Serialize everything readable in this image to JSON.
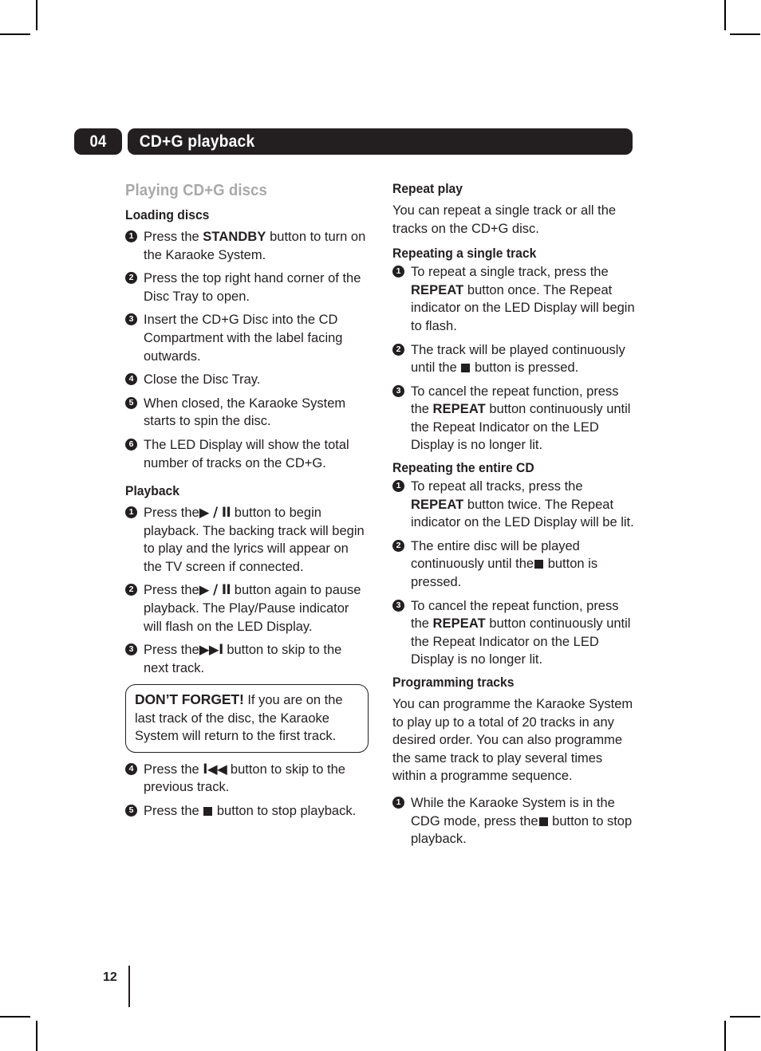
{
  "header": {
    "chapter_number": "04",
    "title": "CD+G playback"
  },
  "left_column": {
    "section_title": "Playing CD+G discs",
    "loading": {
      "heading": "Loading discs",
      "steps": [
        {
          "n": "1",
          "parts": [
            {
              "t": "text",
              "v": "Press the "
            },
            {
              "t": "bold",
              "v": "STANDBY"
            },
            {
              "t": "text",
              "v": "  button to turn on the Karaoke System."
            }
          ]
        },
        {
          "n": "2",
          "parts": [
            {
              "t": "text",
              "v": "Press the top right hand corner of the Disc Tray to open."
            }
          ]
        },
        {
          "n": "3",
          "parts": [
            {
              "t": "text",
              "v": "Insert the CD+G Disc into the CD Compartment with the label facing outwards."
            }
          ]
        },
        {
          "n": "4",
          "parts": [
            {
              "t": "text",
              "v": "Close the Disc Tray."
            }
          ]
        },
        {
          "n": "5",
          "parts": [
            {
              "t": "text",
              "v": "When closed, the Karaoke System starts to spin the disc."
            }
          ]
        },
        {
          "n": "6",
          "parts": [
            {
              "t": "text",
              "v": "The LED Display will show the total number of tracks on the CD+G."
            }
          ]
        }
      ]
    },
    "playback": {
      "heading": "Playback",
      "steps_before_callout": [
        {
          "n": "1",
          "parts": [
            {
              "t": "text",
              "v": "Press the"
            },
            {
              "t": "glyph",
              "v": "▶ / II"
            },
            {
              "t": "text",
              "v": " button to begin playback. The backing track will begin to play and the lyrics will appear on the TV screen if connected."
            }
          ]
        },
        {
          "n": "2",
          "parts": [
            {
              "t": "text",
              "v": "Press the"
            },
            {
              "t": "glyph",
              "v": "▶ / II"
            },
            {
              "t": "text",
              "v": " button again to pause playback. The Play/Pause indicator will flash on the LED Display."
            }
          ]
        },
        {
          "n": "3",
          "parts": [
            {
              "t": "text",
              "v": "Press the"
            },
            {
              "t": "glyph",
              "v": "▶▶I"
            },
            {
              "t": "text",
              "v": " button to skip to the next track."
            }
          ]
        }
      ],
      "callout": {
        "lead": "DON’T FORGET!",
        "body": "  If you are on the last track of the disc, the Karaoke System will return to the first track."
      },
      "steps_after_callout": [
        {
          "n": "4",
          "parts": [
            {
              "t": "text",
              "v": "Press the "
            },
            {
              "t": "glyph",
              "v": "I◀◀"
            },
            {
              "t": "text",
              "v": " button to skip to the previous track."
            }
          ]
        },
        {
          "n": "5",
          "parts": [
            {
              "t": "text",
              "v": "Press the "
            },
            {
              "t": "stop",
              "v": ""
            },
            {
              "t": "text",
              "v": " button to stop playback."
            }
          ]
        }
      ]
    }
  },
  "right_column": {
    "repeat_play": {
      "heading": "Repeat play",
      "intro": "You can repeat a single track or all the tracks on the CD+G disc."
    },
    "repeat_single": {
      "heading": "Repeating a single track",
      "steps": [
        {
          "n": "1",
          "parts": [
            {
              "t": "text",
              "v": "To repeat a single track, press the "
            },
            {
              "t": "bold",
              "v": "REPEAT"
            },
            {
              "t": "text",
              "v": "  button once. The Repeat indicator on the LED Display will begin to flash."
            }
          ]
        },
        {
          "n": "2",
          "parts": [
            {
              "t": "text",
              "v": "The track will be played continuously until the "
            },
            {
              "t": "stop",
              "v": ""
            },
            {
              "t": "text",
              "v": " button is pressed."
            }
          ]
        },
        {
          "n": "3",
          "parts": [
            {
              "t": "text",
              "v": "To cancel the repeat function, press the "
            },
            {
              "t": "bold",
              "v": "REPEAT"
            },
            {
              "t": "text",
              "v": "  button continuously until the Repeat Indicator on the LED Display is no longer lit."
            }
          ]
        }
      ]
    },
    "repeat_entire": {
      "heading": "Repeating the entire CD",
      "steps": [
        {
          "n": "1",
          "parts": [
            {
              "t": "text",
              "v": "To repeat all tracks, press the "
            },
            {
              "t": "bold",
              "v": "REPEAT"
            },
            {
              "t": "text",
              "v": "  button twice. The Repeat indicator on the LED Display will be lit."
            }
          ]
        },
        {
          "n": "2",
          "parts": [
            {
              "t": "text",
              "v": "The entire disc will be played continuously until the"
            },
            {
              "t": "stop",
              "v": ""
            },
            {
              "t": "text",
              "v": " button is pressed."
            }
          ]
        },
        {
          "n": "3",
          "parts": [
            {
              "t": "text",
              "v": "To cancel the repeat function, press the "
            },
            {
              "t": "bold",
              "v": "REPEAT"
            },
            {
              "t": "text",
              "v": "  button continuously until the Repeat Indicator on the LED Display is no longer lit."
            }
          ]
        }
      ]
    },
    "programming": {
      "heading": "Programming tracks",
      "intro": "You can programme the Karaoke System to play up to a total of 20 tracks in any desired order. You can also programme the same track to play several times within a programme sequence.",
      "steps": [
        {
          "n": "1",
          "parts": [
            {
              "t": "text",
              "v": "While the Karaoke System is in the CDG mode, press the"
            },
            {
              "t": "stop",
              "v": ""
            },
            {
              "t": "text",
              "v": " button to stop playback."
            }
          ]
        }
      ]
    }
  },
  "footer": {
    "page_number": "12"
  }
}
